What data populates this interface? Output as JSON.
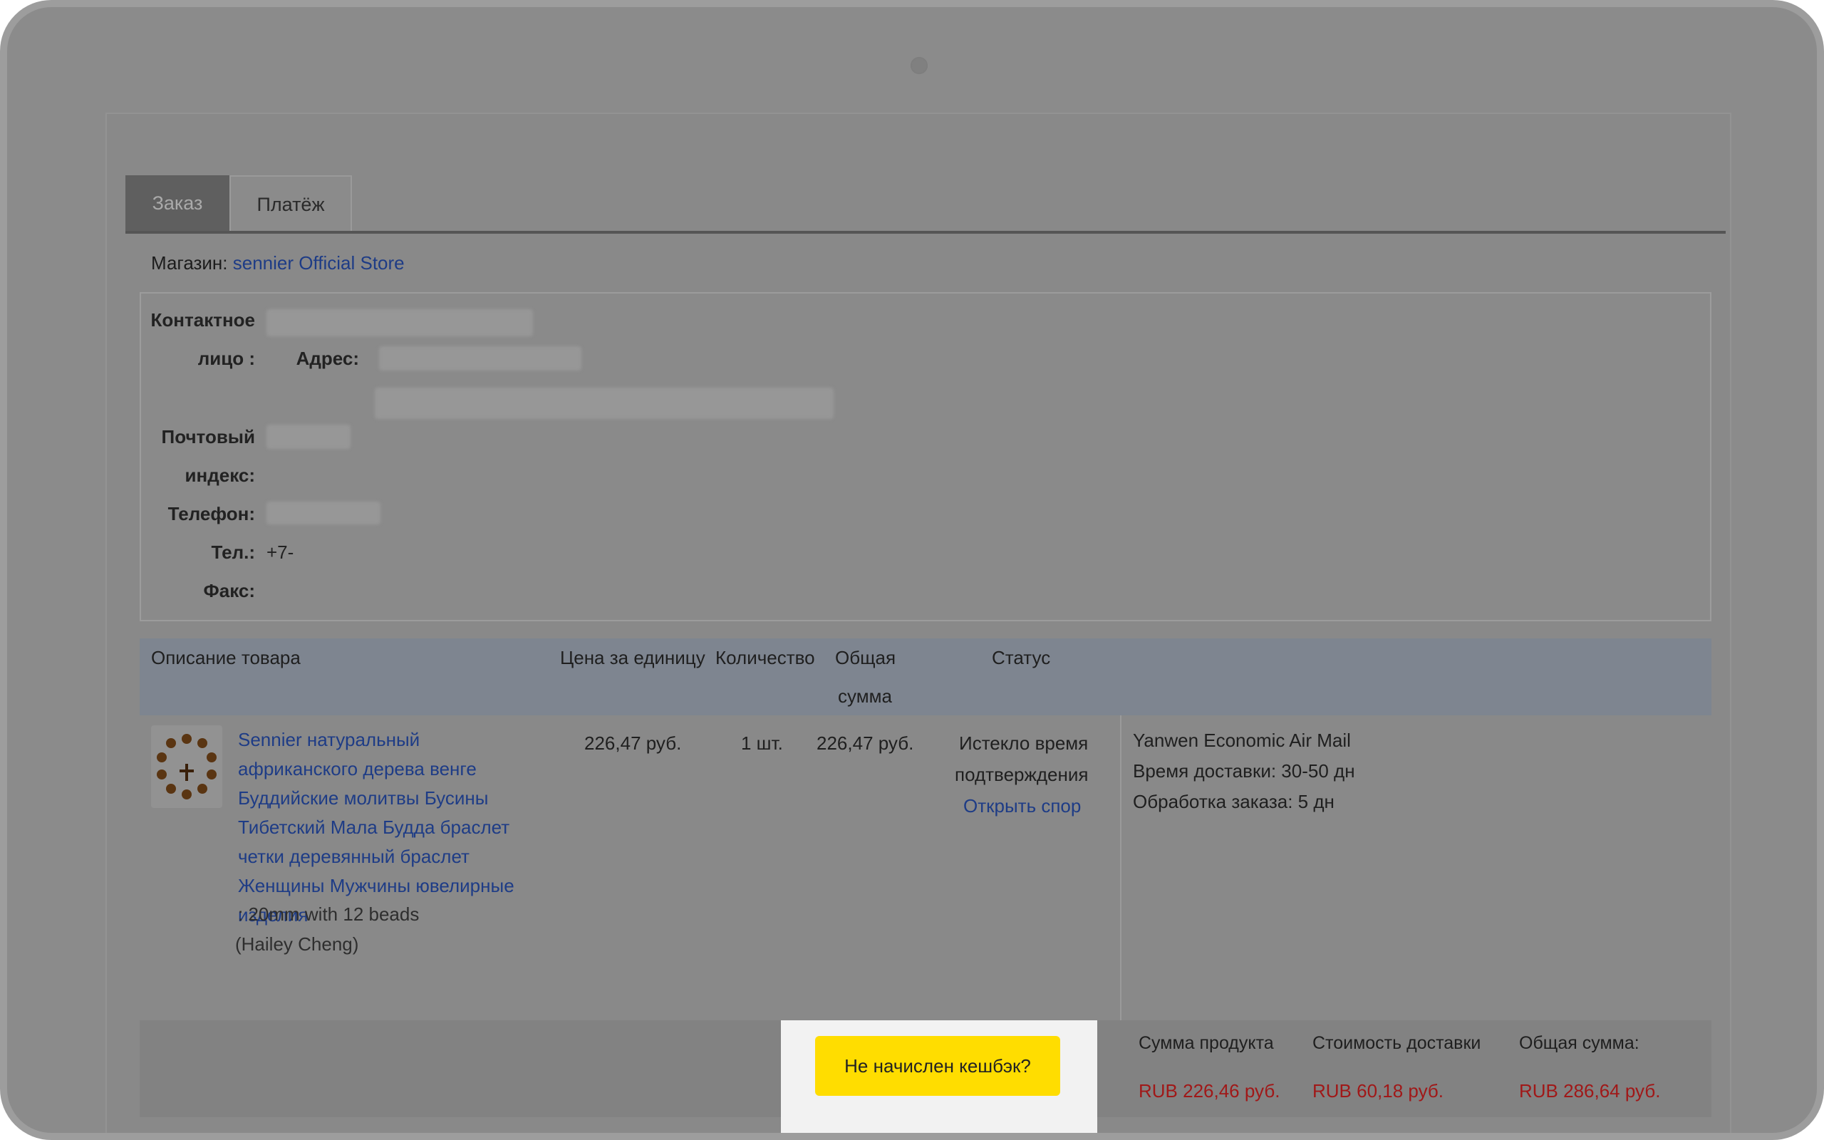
{
  "tabs": [
    {
      "label": "Заказ",
      "active": true
    },
    {
      "label": "Платёж",
      "active": false
    }
  ],
  "shop": {
    "label": "Магазин:",
    "name": "sennier Official Store"
  },
  "contact": {
    "person_label_1": "Контактное",
    "person_label_2": "лицо :",
    "address_label": "Адрес:",
    "postal_label_1": "Почтовый",
    "postal_label_2": "индекс:",
    "phone_label": "Телефон:",
    "tel_label": "Тел.:",
    "tel_value": "+7-",
    "fax_label": "Факс:"
  },
  "table": {
    "headers": {
      "description": "Описание товара",
      "unit_price": "Цена за единицу",
      "quantity": "Количество",
      "total_1": "Общая",
      "total_2": "сумма",
      "status": "Статус"
    },
    "item": {
      "title": "Sennier натуральный африканского дерева венге Буддийские молитвы Бусины Тибетский Мала Будда браслет четки деревянный браслет Женщины Мужчины ювелирные изделия",
      "variant": ": 20mm with 12 beads",
      "seller": "(Hailey Cheng)",
      "unit_price": "226,47 руб.",
      "quantity": "1 шт.",
      "total": "226,47 руб.",
      "status_1": "Истекло время",
      "status_2": "подтверждения",
      "dispute_link": "Открыть спор",
      "shipping_method": "Yanwen Economic Air Mail",
      "delivery_time": "Время доставки: 30-50 дн",
      "processing_time": "Обработка заказа: 5 дн"
    }
  },
  "footer": {
    "cashback_button": "Не начислен кешбэк?",
    "product_sum_label": "Сумма продукта",
    "product_sum_value": "RUB 226,46 руб.",
    "shipping_cost_label": "Стоимость доставки",
    "shipping_cost_value": "RUB 60,18 руб.",
    "grand_total_label": "Общая сумма:",
    "grand_total_value": "RUB 286,64 руб."
  },
  "colors": {
    "accent_button": "#ffdd00",
    "price_red": "#a01818",
    "link_blue": "#1e3c86"
  }
}
